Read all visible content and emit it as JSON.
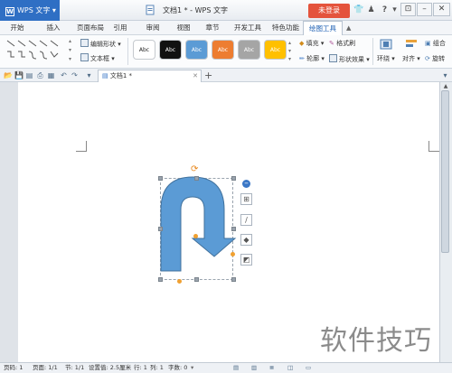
{
  "app": {
    "menu_label": "WPS 文字",
    "document_title": "文档1 * - WPS 文字",
    "login_label": "未登录"
  },
  "menu_tabs": [
    "开始",
    "插入",
    "页面布局",
    "引用",
    "审阅",
    "视图",
    "章节",
    "开发工具",
    "特色功能",
    "绘图工具"
  ],
  "ribbon": {
    "edit_shape_label": "编辑形状",
    "textbox_label": "文本框",
    "style_swatches": [
      {
        "label": "Abc",
        "bg": "#ffffff",
        "fg": "#222222"
      },
      {
        "label": "Abc",
        "bg": "#111111",
        "fg": "#ffffff"
      },
      {
        "label": "Abc",
        "bg": "#5b9bd5",
        "fg": "#ffffff"
      },
      {
        "label": "Abc",
        "bg": "#ed7d31",
        "fg": "#ffffff"
      },
      {
        "label": "Abc",
        "bg": "#a5a5a5",
        "fg": "#ffffff"
      },
      {
        "label": "Abc",
        "bg": "#ffc000",
        "fg": "#ffffff"
      }
    ],
    "fill_label": "填充",
    "format_painter_label": "格式刷",
    "outline_label": "轮廓",
    "shape_effects_label": "形状效果",
    "wrap_label": "环绕",
    "align_label": "对齐",
    "group_label": "组合",
    "rotate_label": "旋转"
  },
  "document_tab": {
    "label": "文档1 *"
  },
  "status_bar": {
    "page_num": "页码: 1",
    "pages": "页面: 1/1",
    "section": "节: 1/1",
    "setting": "设置值: 2.5厘米",
    "row": "行: 1",
    "col": "列: 1",
    "word_count": "字数: 0"
  },
  "shape": {
    "name": "U-turn arrow",
    "fill": "#5b9bd5",
    "stroke": "#41719c"
  },
  "watermark": "软件技巧",
  "colors": {
    "accent": "#2f6fc4",
    "login": "#e4533c"
  }
}
